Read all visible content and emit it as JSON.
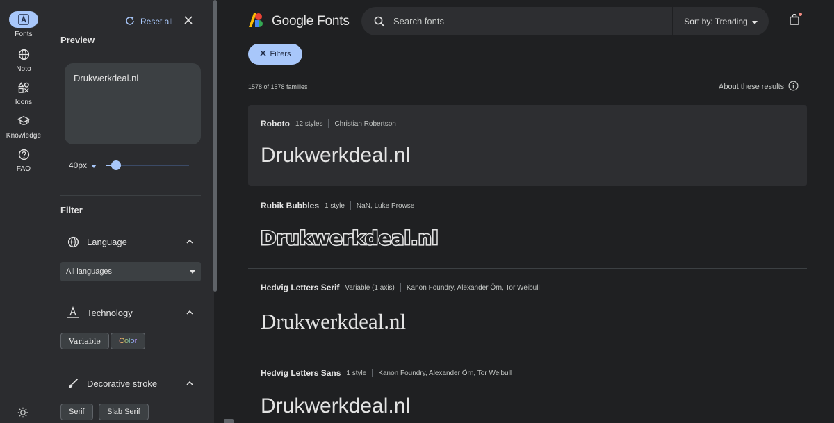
{
  "rail": {
    "items": [
      {
        "label": "Fonts",
        "icon": "font-a-icon",
        "active": true
      },
      {
        "label": "Noto",
        "icon": "globe-icon"
      },
      {
        "label": "Icons",
        "icon": "shapes-icon"
      },
      {
        "label": "Knowledge",
        "icon": "school-icon"
      },
      {
        "label": "FAQ",
        "icon": "help-icon"
      }
    ],
    "theme_icon": "light-mode-icon"
  },
  "panel": {
    "reset_label": "Reset all",
    "preview_heading": "Preview",
    "preview_text": "Drukwerkdeal.nl",
    "font_size": "40px",
    "font_size_level": 0.08,
    "filter_heading": "Filter",
    "sections": {
      "language": "Language",
      "technology": "Technology",
      "decorative": "Decorative stroke"
    },
    "language_value": "All languages",
    "tech_chips": [
      "Variable",
      "Color"
    ],
    "stroke_chips": [
      "Serif",
      "Slab Serif"
    ]
  },
  "header": {
    "logo_text": "Google Fonts",
    "search_placeholder": "Search fonts",
    "sort_label": "Sort by: Trending"
  },
  "results": {
    "filters_label": "Filters",
    "count": "1578 of 1578 families",
    "about": "About these results"
  },
  "fonts": [
    {
      "name": "Roboto",
      "styles": "12 styles",
      "author": "Christian Robertson",
      "sample": "Drukwerkdeal.nl"
    },
    {
      "name": "Rubik Bubbles",
      "styles": "1 style",
      "author": "NaN, Luke Prowse",
      "sample": "Drukwerkdeal.nl"
    },
    {
      "name": "Hedvig Letters Serif",
      "styles": "Variable (1 axis)",
      "author": "Kanon Foundry, Alexander Örn, Tor Weibull",
      "sample": "Drukwerkdeal.nl"
    },
    {
      "name": "Hedvig Letters Sans",
      "styles": "1 style",
      "author": "Kanon Foundry, Alexander Örn, Tor Weibull",
      "sample": "Drukwerkdeal.nl"
    }
  ],
  "colors": {
    "accent": "#a8c7fa",
    "background": "#1f2022",
    "panel": "#2b2c2f",
    "card_hover": "#2d2e31"
  }
}
